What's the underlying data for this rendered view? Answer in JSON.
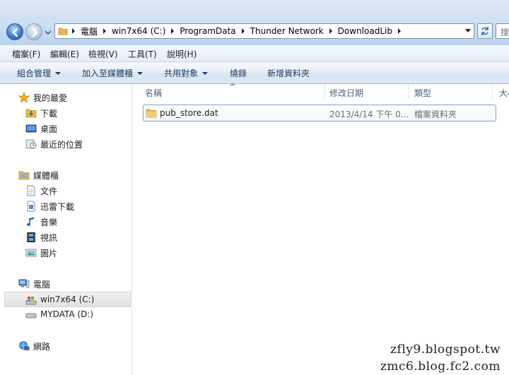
{
  "address": {
    "breadcrumbs": [
      "電腦",
      "win7x64 (C:)",
      "ProgramData",
      "Thunder Network",
      "DownloadLib"
    ],
    "search_text": "搜"
  },
  "menu": [
    "檔案(F)",
    "編輯(E)",
    "檢視(V)",
    "工具(T)",
    "說明(H)"
  ],
  "commands": [
    {
      "label": "組合管理",
      "dropdown": true
    },
    {
      "label": "加入至媒體櫃",
      "dropdown": true
    },
    {
      "label": "共用對象",
      "dropdown": true
    },
    {
      "label": "燒錄",
      "dropdown": false
    },
    {
      "label": "新增資料夾",
      "dropdown": false
    }
  ],
  "nav": {
    "favorites": {
      "label": "我的最愛",
      "items": [
        "下載",
        "桌面",
        "最近的位置"
      ]
    },
    "libraries": {
      "label": "媒體櫃",
      "items": [
        "文件",
        "迅雷下載",
        "音樂",
        "視訊",
        "圖片"
      ]
    },
    "computer": {
      "label": "電腦",
      "items": [
        "win7x64 (C:)",
        "MYDATA (D:)"
      ]
    },
    "network": {
      "label": "網路"
    }
  },
  "columns": {
    "name": "名稱",
    "modified": "修改日期",
    "type": "類型",
    "size": "大小"
  },
  "files": [
    {
      "name": "pub_store.dat",
      "modified": "2013/4/14 下午 0...",
      "type": "檔案資料夾"
    }
  ],
  "watermark": [
    "zfly9.blogspot.tw",
    "zmc6.blog.fc2.com"
  ],
  "colors": {
    "accent": "#3a7bd5",
    "selection_border": "#7da2ce",
    "folder": "#e8b84a"
  }
}
